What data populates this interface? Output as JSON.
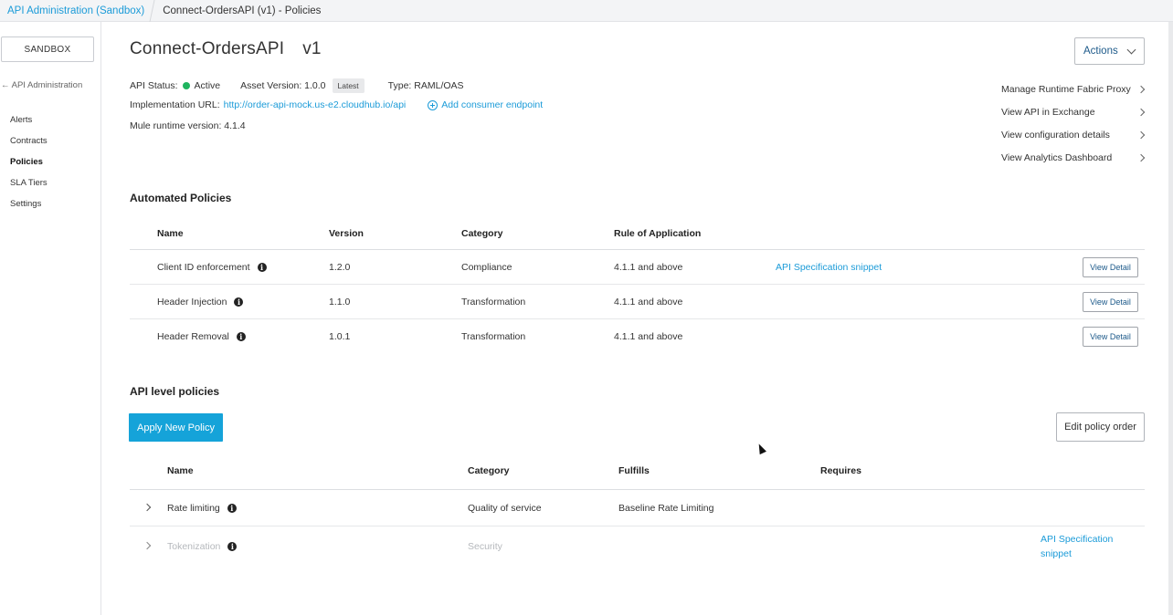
{
  "breadcrumb": {
    "root": "API Administration (Sandbox)",
    "current": "Connect-OrdersAPI (v1) - Policies"
  },
  "sidebar": {
    "env_button": "SANDBOX",
    "back_link": "← API Administration",
    "items": [
      {
        "label": "Alerts"
      },
      {
        "label": "Contracts"
      },
      {
        "label": "Policies",
        "active": true
      },
      {
        "label": "SLA Tiers"
      },
      {
        "label": "Settings"
      }
    ]
  },
  "header": {
    "api_name": "Connect-OrdersAPI",
    "version": "v1",
    "actions_label": "Actions"
  },
  "info": {
    "status_label": "API Status:",
    "status_value": "Active",
    "status_color": "#1fb45f",
    "asset_version_label": "Asset Version: 1.0.0",
    "latest_badge": "Latest",
    "type_label": "Type: RAML/OAS",
    "impl_label": "Implementation URL:",
    "impl_url": "http://order-api-mock.us-e2.cloudhub.io/api",
    "add_endpoint": "Add consumer endpoint",
    "runtime_label": "Mule runtime version: 4.1.4"
  },
  "right_links": [
    "Manage Runtime Fabric Proxy",
    "View API in Exchange",
    "View configuration details",
    "View Analytics Dashboard"
  ],
  "automated": {
    "title": "Automated Policies",
    "headers": [
      "Name",
      "Version",
      "Category",
      "Rule of Application"
    ],
    "rows": [
      {
        "name": "Client ID enforcement",
        "version": "1.2.0",
        "category": "Compliance",
        "rule": "4.1.1 and above",
        "snippet": "API Specification snippet",
        "button": "View Detail"
      },
      {
        "name": "Header Injection",
        "version": "1.1.0",
        "category": "Transformation",
        "rule": "4.1.1 and above",
        "snippet": "",
        "button": "View Detail"
      },
      {
        "name": "Header Removal",
        "version": "1.0.1",
        "category": "Transformation",
        "rule": "4.1.1 and above",
        "snippet": "",
        "button": "View Detail"
      }
    ]
  },
  "api_level": {
    "title": "API level policies",
    "apply_button": "Apply New Policy",
    "edit_order_button": "Edit policy order",
    "headers": [
      "Name",
      "Category",
      "Fulfills",
      "Requires"
    ],
    "rows": [
      {
        "name": "Rate limiting",
        "category": "Quality of service",
        "fulfills": "Baseline Rate Limiting",
        "requires": "",
        "snippet_line1": "",
        "snippet_line2": ""
      },
      {
        "name": "Tokenization",
        "category": "Security",
        "fulfills": "",
        "requires": "",
        "snippet_line1": "API Specification",
        "snippet_line2": "snippet"
      }
    ]
  },
  "colors": {
    "accent": "#1b9bd8",
    "primary_button": "#15a3d9"
  }
}
